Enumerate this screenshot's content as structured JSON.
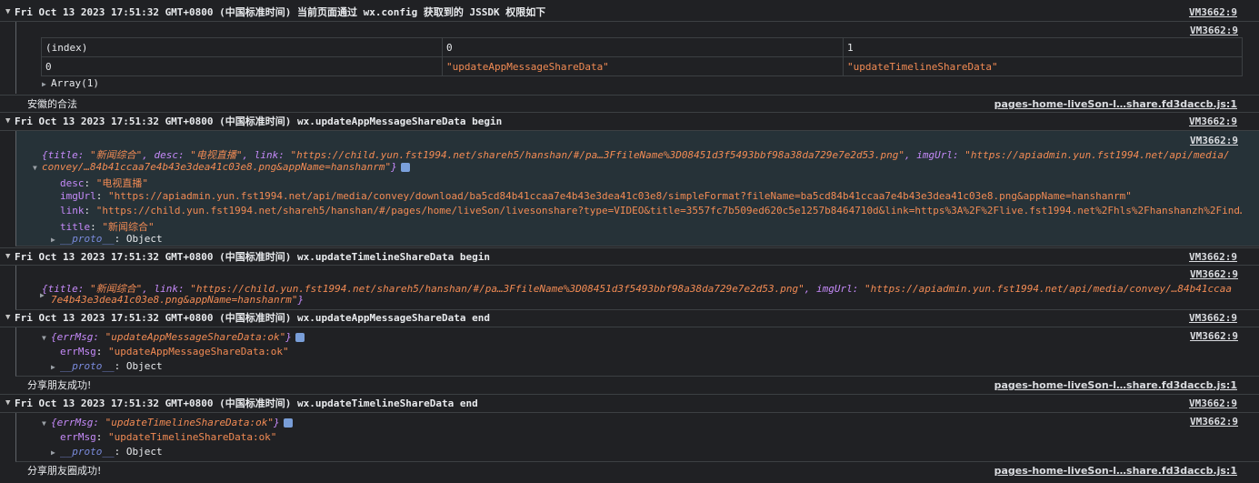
{
  "sources": {
    "vm": "VM3662:9",
    "page": "pages-home-liveSon-l…share.fd3daccb.js:1"
  },
  "g1": {
    "header": "Fri Oct 13 2023 17:51:32 GMT+0800 (中国标准时间) 当前页面通过 wx.config 获取到的 JSSDK 权限如下",
    "table": {
      "headers": [
        "(index)",
        "0",
        "1"
      ],
      "row_index": "0",
      "cells": [
        "\"updateAppMessageShareData\"",
        "\"updateTimelineShareData\""
      ]
    },
    "array_label": "Array(1)"
  },
  "log1": "安徽的合法",
  "g2": {
    "header": "Fri Oct 13 2023 17:51:32 GMT+0800 (中国标准时间) wx.updateAppMessageShareData begin",
    "summary_line1_prefix": "{title: ",
    "summary_title": "\"新闻综合\"",
    "summary_desc_key": ", desc: ",
    "summary_desc": "\"电视直播\"",
    "summary_link_key": ", link: ",
    "summary_link": "\"https://child.yun.fst1994.net/shareh5/hanshan/#/pa…3FfileName%3D08451d3f5493bbf98a38da729e7e2d53.png\"",
    "summary_img_key": ", imgUrl: ",
    "summary_img": "\"https://apiadmin.yun.fst1994.net/api/media/",
    "summary_line2": "convey/…84b41ccaa7e4b43e3dea41c03e8.png&appName=hanshanrm\"",
    "summary_close": "}",
    "props": [
      {
        "key": "desc",
        "value": "\"电视直播\""
      },
      {
        "key": "imgUrl",
        "value": "\"https://apiadmin.yun.fst1994.net/api/media/convey/download/ba5cd84b41ccaa7e4b43e3dea41c03e8/simpleFormat?fileName=ba5cd84b41ccaa7e4b43e3dea41c03e8.png&appName=hanshanrm\""
      },
      {
        "key": "link",
        "value": "\"https://child.yun.fst1994.net/shareh5/hanshan/#/pages/home/liveSon/livesonshare?type=VIDEO&title=3557fc7b509ed620c5e1257b8464710d&link=https%3A%2F%2Flive.fst1994.net%2Fhls%2Fhanshanzh%2Find…"
      },
      {
        "key": "title",
        "value": "\"新闻综合\""
      }
    ],
    "proto_key": "__proto__",
    "proto_val": "Object"
  },
  "g3": {
    "header": "Fri Oct 13 2023 17:51:32 GMT+0800 (中国标准时间) wx.updateTimelineShareData begin",
    "summary_prefix": "{title: ",
    "summary_title": "\"新闻综合\"",
    "summary_link_key": ", link: ",
    "summary_link": "\"https://child.yun.fst1994.net/shareh5/hanshan/#/pa…3FfileName%3D08451d3f5493bbf98a38da729e7e2d53.png\"",
    "summary_img_key": ", imgUrl: ",
    "summary_img": "\"https://apiadmin.yun.fst1994.net/api/media/convey/…84b41ccaa",
    "summary_line2": "7e4b43e3dea41c03e8.png&appName=hanshanrm\"",
    "summary_close": "}"
  },
  "g4": {
    "header": "Fri Oct 13 2023 17:51:32 GMT+0800 (中国标准时间) wx.updateAppMessageShareData end",
    "summary_prefix": "{errMsg: ",
    "summary_val": "\"updateAppMessageShareData:ok\"",
    "summary_close": "}",
    "prop_key": "errMsg",
    "prop_val": "\"updateAppMessageShareData:ok\"",
    "proto_key": "__proto__",
    "proto_val": "Object"
  },
  "log2": "分享朋友成功!",
  "g5": {
    "header": "Fri Oct 13 2023 17:51:32 GMT+0800 (中国标准时间) wx.updateTimelineShareData end",
    "summary_prefix": "{errMsg: ",
    "summary_val": "\"updateTimelineShareData:ok\"",
    "summary_close": "}",
    "prop_key": "errMsg",
    "prop_val": "\"updateTimelineShareData:ok\"",
    "proto_key": "__proto__",
    "proto_val": "Object"
  },
  "log3": "分享朋友圈成功!",
  "colors": {
    "background": "#202124",
    "string": "#f28b54",
    "key": "#9aa0a6",
    "link": "#dadce0"
  },
  "icons": {
    "expanded": "triangle-down-icon",
    "collapsed": "triangle-right-icon"
  }
}
